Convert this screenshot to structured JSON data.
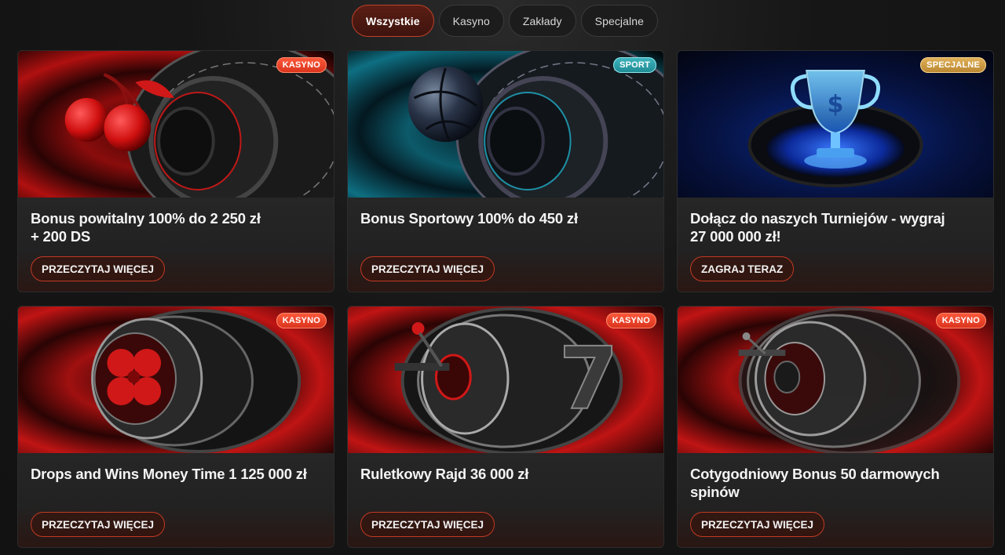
{
  "filters": [
    {
      "label": "Wszystkie",
      "active": true
    },
    {
      "label": "Kasyno",
      "active": false
    },
    {
      "label": "Zakłady",
      "active": false
    },
    {
      "label": "Specjalne",
      "active": false
    }
  ],
  "cards": [
    {
      "badge": "KASYNO",
      "badge_type": "kasyno",
      "title_line1": "Bonus powitalny 100% do 2 250 zł",
      "title_line2": "+ 200 DS",
      "cta": "PRZECZYTAJ WIĘCEJ",
      "image": "cherries-roulette"
    },
    {
      "badge": "SPORT",
      "badge_type": "sport",
      "title_line1": "Bonus Sportowy 100% do 450 zł",
      "title_line2": "",
      "cta": "PRZECZYTAJ WIĘCEJ",
      "image": "ball-roulette"
    },
    {
      "badge": "SPECJALNE",
      "badge_type": "specjalne",
      "title_line1": "Dołącz do naszych Turniejów - wygraj",
      "title_line2": "27 000 000 zł!",
      "cta": "ZAGRAJ TERAZ",
      "image": "trophy"
    },
    {
      "badge": "KASYNO",
      "badge_type": "kasyno",
      "title_line1": "Drops and Wins Money Time 1 125 000 zł",
      "title_line2": "",
      "cta": "PRZECZYTAJ WIĘCEJ",
      "image": "clover-reel"
    },
    {
      "badge": "KASYNO",
      "badge_type": "kasyno",
      "title_line1": "Ruletkowy Rajd 36 000 zł",
      "title_line2": "",
      "cta": "PRZECZYTAJ WIĘCEJ",
      "image": "seven-reel"
    },
    {
      "badge": "KASYNO",
      "badge_type": "kasyno",
      "title_line1": "Cotygodniowy Bonus 50 darmowych",
      "title_line2": "spinów",
      "cta": "PRZECZYTAJ WIĘCEJ",
      "image": "spin-reel"
    }
  ],
  "colors": {
    "accent": "#c23a24",
    "kasyno_badge": "#e8402a",
    "sport_badge": "#2fa0a8",
    "specjalne_badge": "#d4a24a",
    "background": "#141414"
  }
}
